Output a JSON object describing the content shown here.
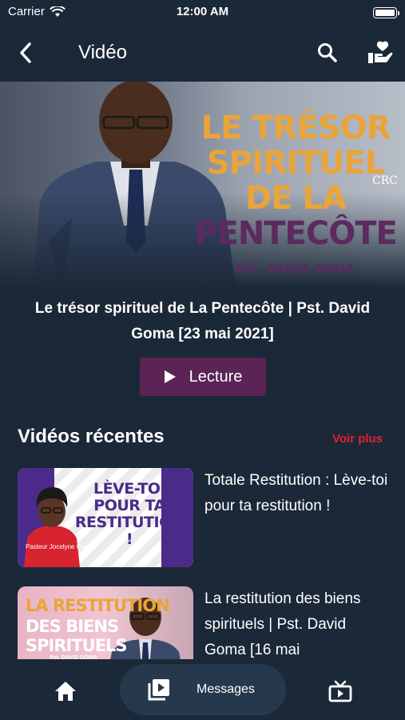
{
  "status_bar": {
    "carrier": "Carrier",
    "time": "12:00 AM"
  },
  "header": {
    "title": "Vidéo"
  },
  "featured": {
    "thumbnail": {
      "line1": "LE TRÉSOR",
      "line2": "SPIRITUEL DE LA",
      "line3": "PENTECÔTE",
      "author": "Pst. DAVID GOMA",
      "logo": "CRC"
    },
    "title": "Le trésor spirituel de La Pentecôte | Pst. David Goma [23 mai 2021]",
    "play_label": "Lecture"
  },
  "recent": {
    "section_title": "Vidéos récentes",
    "see_more": "Voir plus",
    "items": [
      {
        "title": "Totale Restitution : Lève-toi pour ta restitution !",
        "thumb_slogan": "LÈVE-TOI POUR TA RESTITUTION !",
        "thumb_speaker": "Pasteur Jocelyne Goma"
      },
      {
        "title": "La restitution des biens spirituels | Pst. David Goma [16 mai",
        "thumb_line1": "LA RESTITUTION",
        "thumb_line2": "DES BIENS",
        "thumb_line3": "SPIRITUELS",
        "thumb_author": "Pst. DAVID GOMA"
      }
    ]
  },
  "bottom_nav": {
    "messages_label": "Messages"
  },
  "colors": {
    "background": "#1b2838",
    "accent": "#5b2454",
    "see_more": "#e02232",
    "nav_pill": "#26384c"
  }
}
